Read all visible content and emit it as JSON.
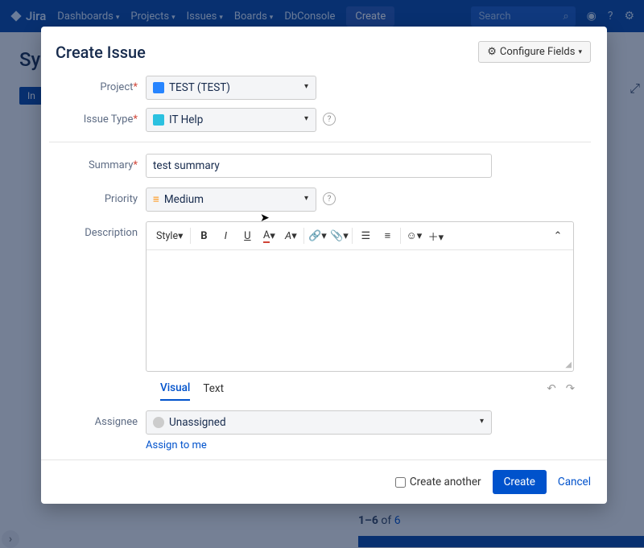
{
  "app": {
    "name": "Jira"
  },
  "topbar": {
    "items": [
      "Dashboards",
      "Projects",
      "Issues",
      "Boards",
      "DbConsole"
    ],
    "create": "Create",
    "search_placeholder": "Search"
  },
  "background": {
    "title_fragment": "Sys",
    "tab_fragment": "In",
    "pagination_prefix": "1–6",
    "pagination_of": " of ",
    "pagination_total": "6"
  },
  "modal": {
    "title": "Create Issue",
    "configure": "Configure Fields",
    "labels": {
      "project": "Project",
      "issue_type": "Issue Type",
      "summary": "Summary",
      "priority": "Priority",
      "description": "Description",
      "assignee": "Assignee"
    },
    "values": {
      "project": "TEST (TEST)",
      "issue_type": "IT Help",
      "summary": "test summary",
      "priority": "Medium",
      "assignee": "Unassigned"
    },
    "toolbar": {
      "style": "Style"
    },
    "editor_tabs": {
      "visual": "Visual",
      "text": "Text"
    },
    "assign_to_me": "Assign to me",
    "footer": {
      "create_another": "Create another",
      "create": "Create",
      "cancel": "Cancel"
    }
  }
}
